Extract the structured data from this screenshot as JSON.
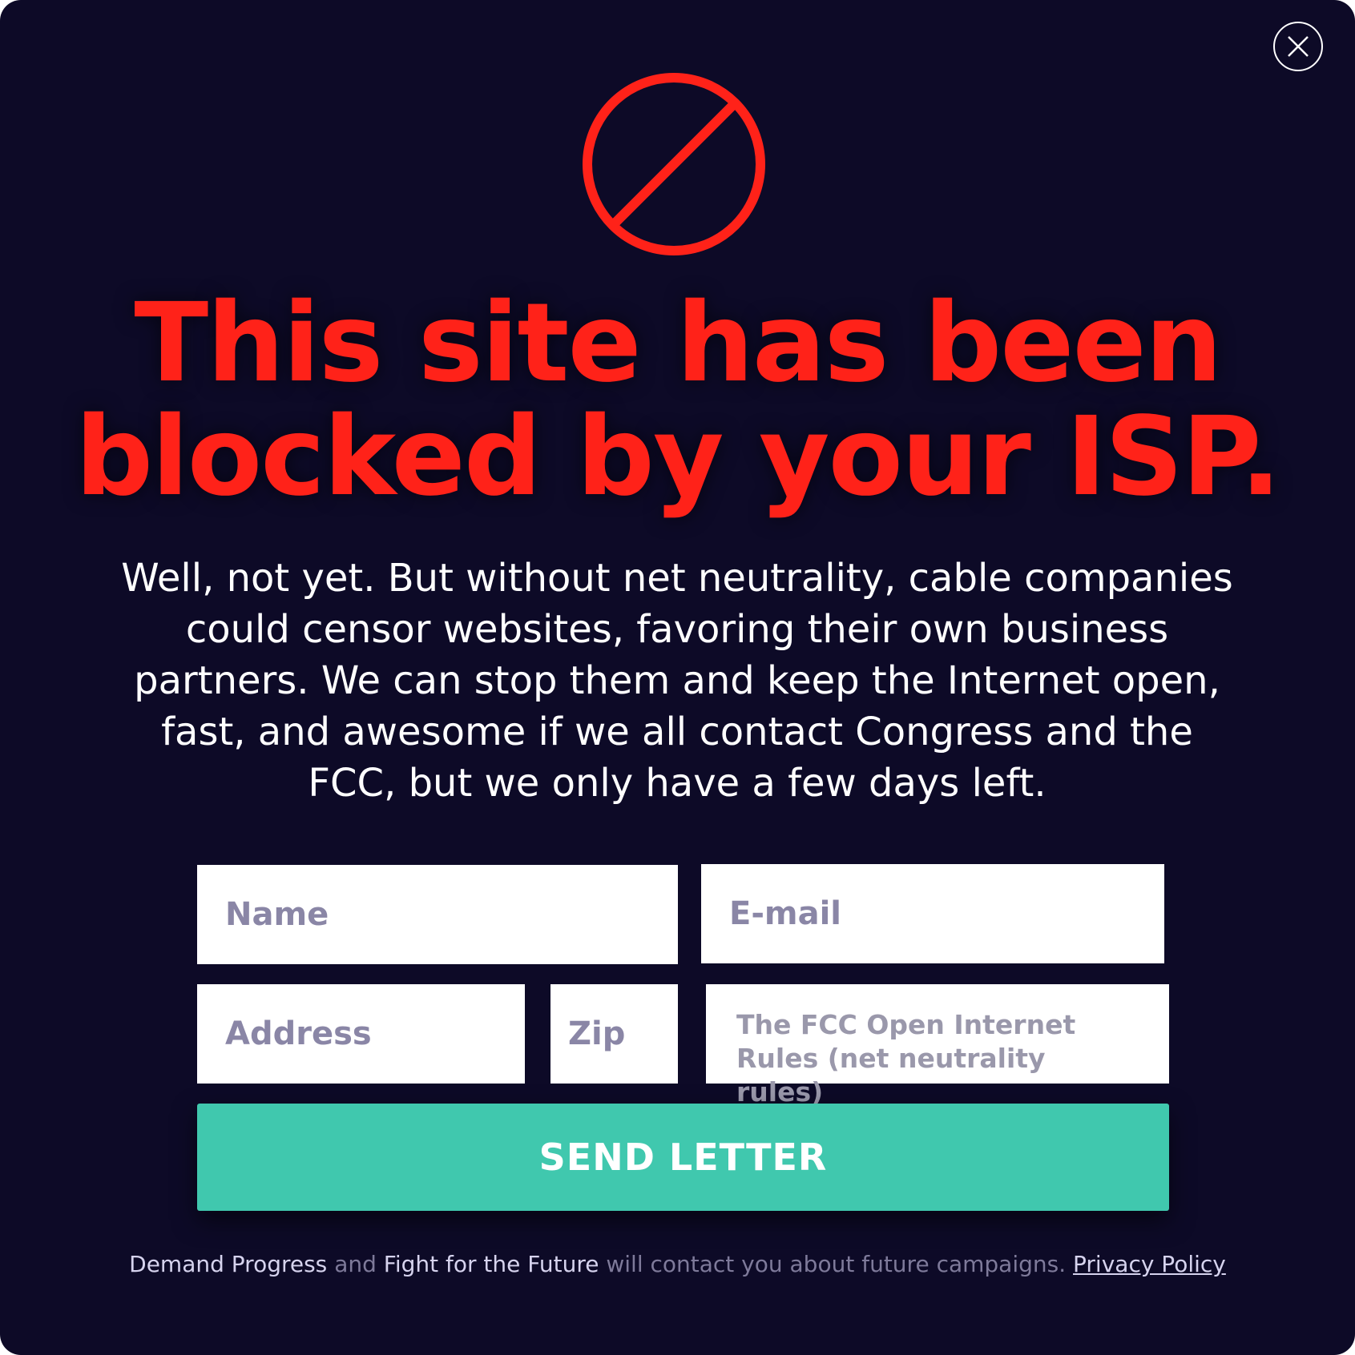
{
  "colors": {
    "background": "#0d0a27",
    "accent_red": "#ff2219",
    "button_teal": "#40c8ae"
  },
  "close_button": {
    "icon": "close-icon"
  },
  "block_icon": {
    "icon": "prohibited-icon"
  },
  "headline": {
    "line1": "This site has been",
    "line2": "blocked by your ISP."
  },
  "subtext": {
    "line1": "Well, not yet. But without net neutrality, cable companies",
    "line2": "could censor websites, favoring their own business",
    "line3": "partners. We can stop them and keep the Internet open,",
    "line4": "fast, and awesome if we all contact Congress and the",
    "line5": "FCC, but we only have a few days left."
  },
  "form": {
    "name_placeholder": "Name",
    "email_placeholder": "E-mail",
    "address_placeholder": "Address",
    "zip_placeholder": "Zip",
    "topic_line1": "The FCC Open Internet",
    "topic_line2": "Rules (net neutrality rules)",
    "submit_label": "SEND LETTER"
  },
  "footer": {
    "org1": "Demand Progress",
    "and": "and",
    "org2": "Fight for the Future",
    "text": "will contact you about future  campaigns.",
    "privacy_link": "Privacy Policy"
  }
}
